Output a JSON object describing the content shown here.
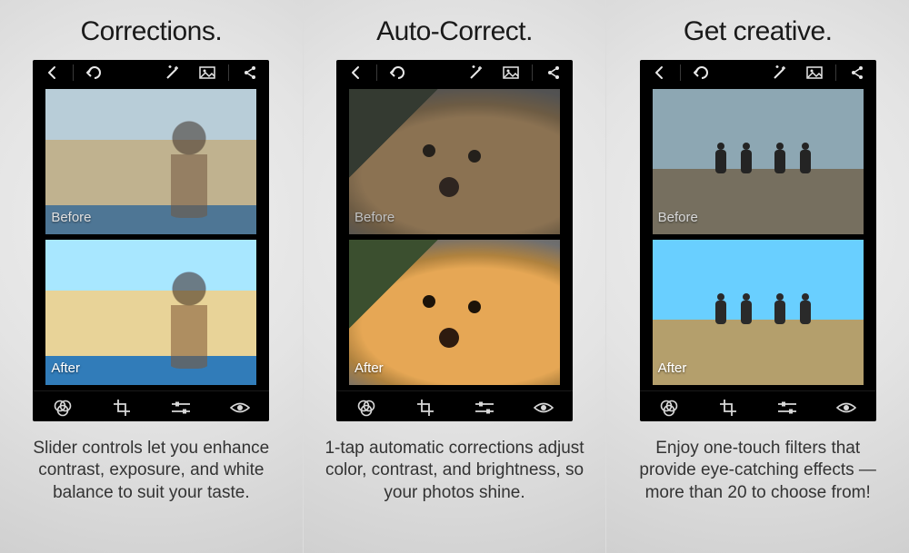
{
  "panels": [
    {
      "headline": "Corrections.",
      "before_label": "Before",
      "after_label": "After",
      "caption": "Slider controls let you enhance contrast, exposure, and white balance to suit your taste.",
      "before_class": "beach-before",
      "after_class": "beach-after"
    },
    {
      "headline": "Auto-Correct.",
      "before_label": "Before",
      "after_label": "After",
      "caption": "1-tap automatic corrections adjust color, contrast, and brightness, so your photos shine.",
      "before_class": "dog-before",
      "after_class": "dog-after"
    },
    {
      "headline": "Get creative.",
      "before_label": "Before",
      "after_label": "After",
      "caption": "Enjoy one-touch filters that provide eye-catching effects — more than 20 to choose from!",
      "before_class": "kids-before",
      "after_class": "kids-after"
    }
  ],
  "toolbar_icons": [
    "back",
    "undo",
    "magic-wand",
    "image",
    "share"
  ],
  "bottom_icons": [
    "filters",
    "crop",
    "sliders",
    "redeye"
  ]
}
